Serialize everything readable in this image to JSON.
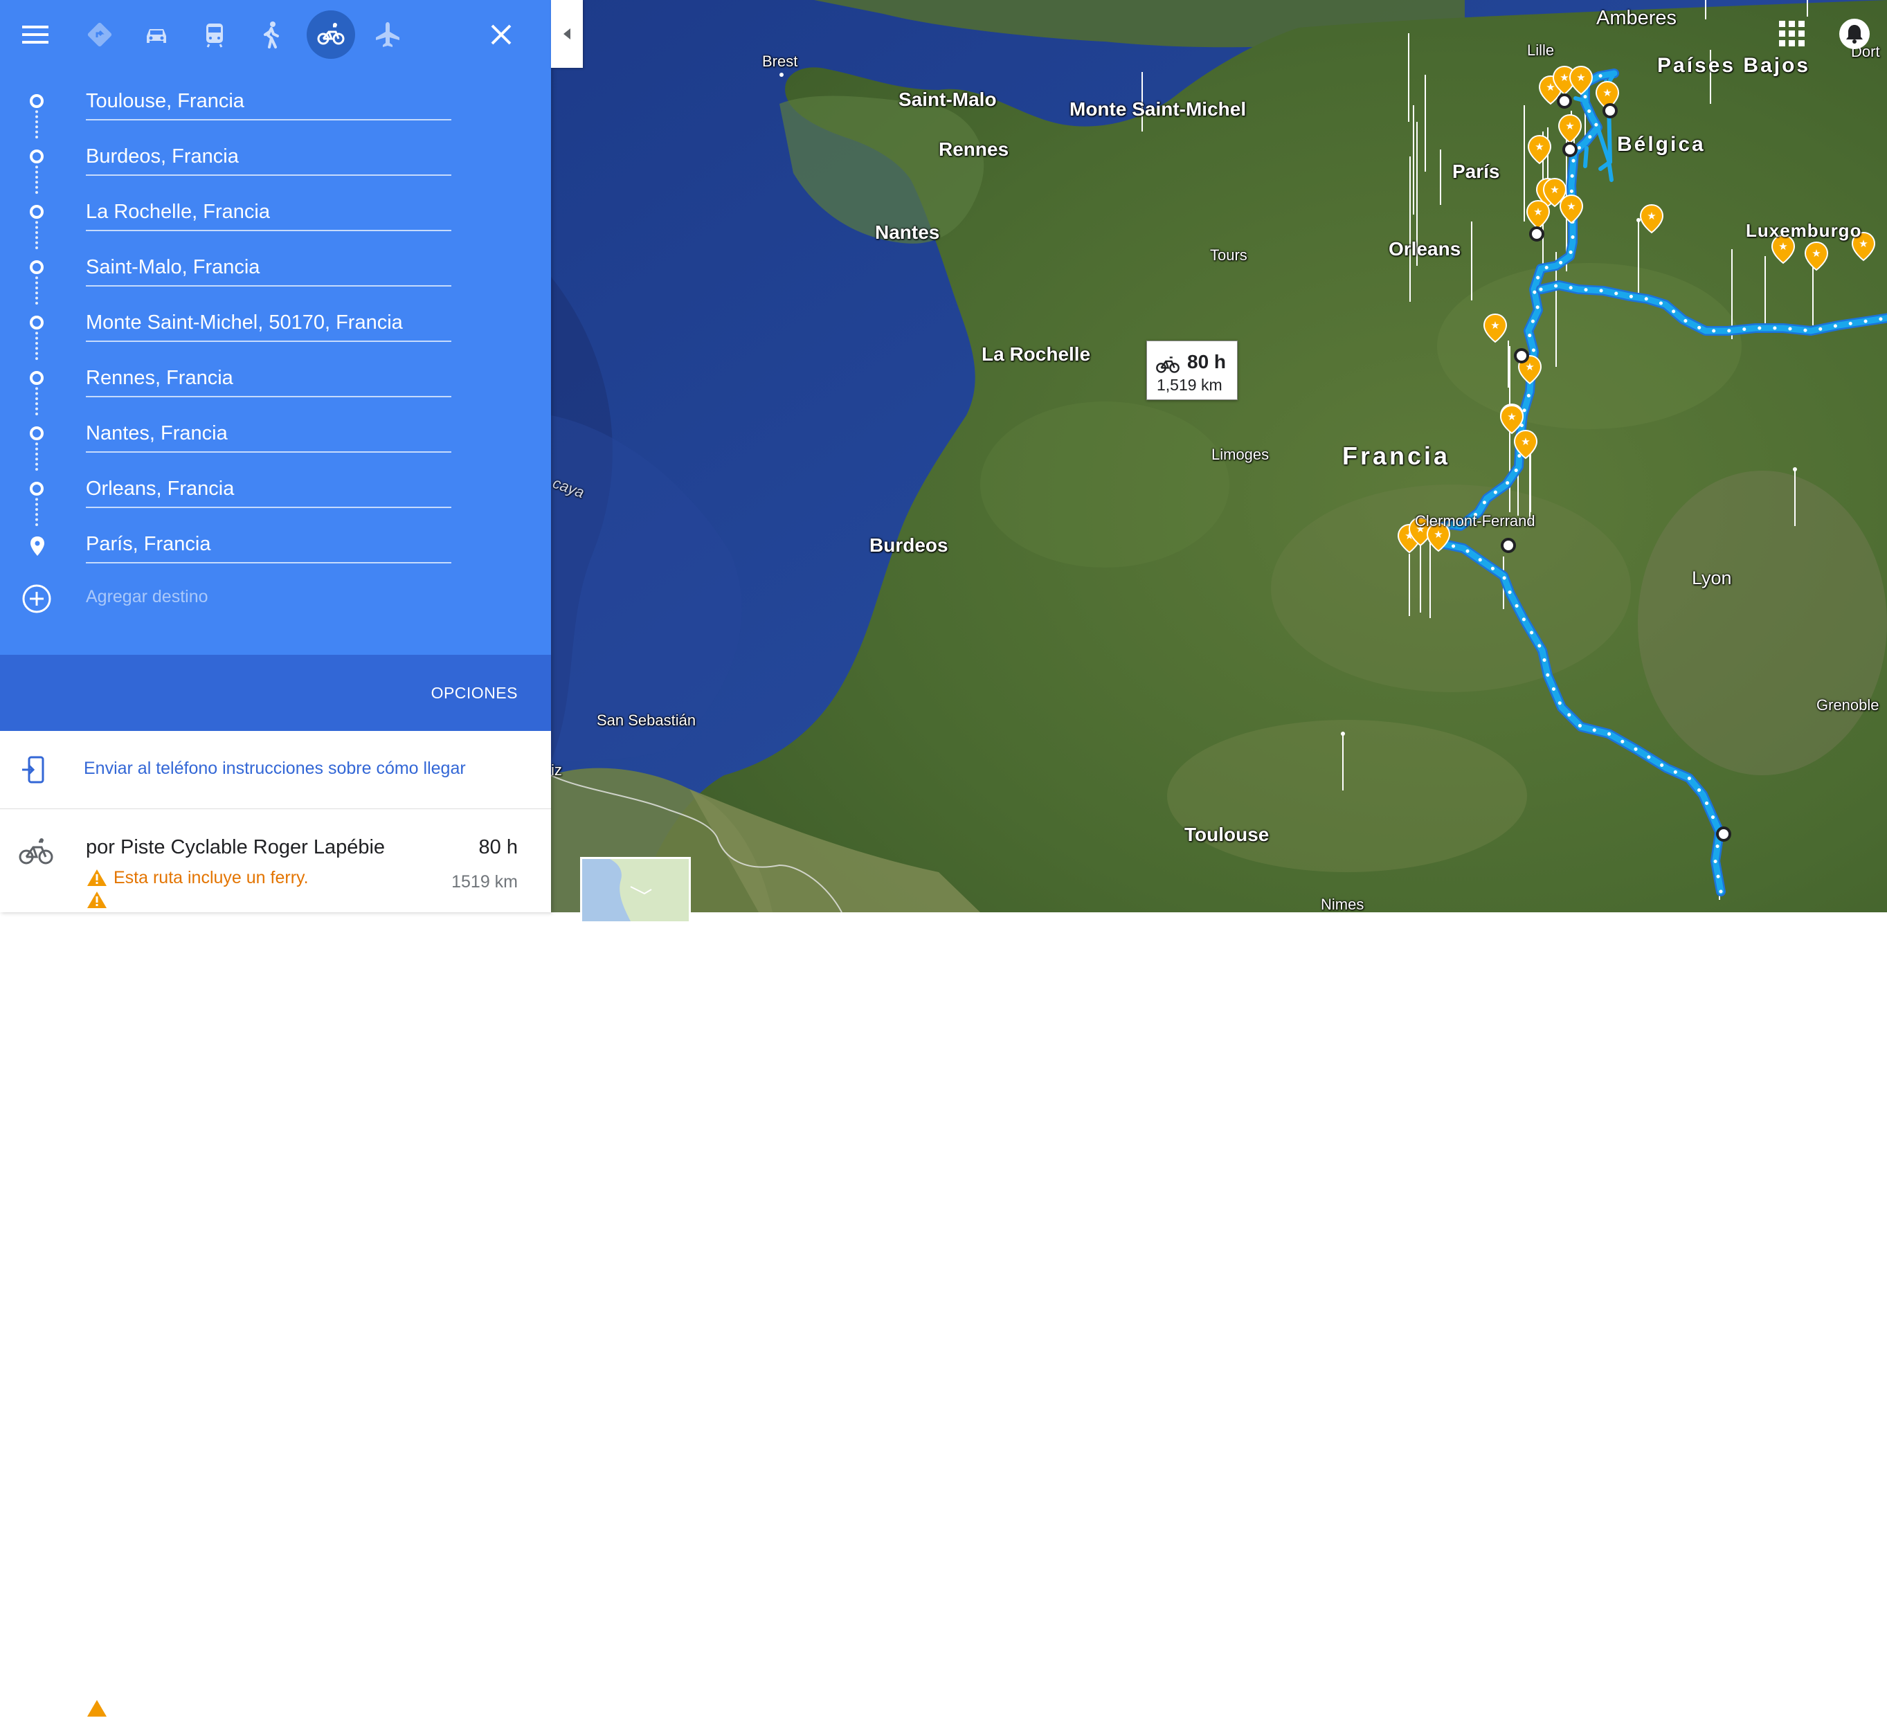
{
  "panel": {
    "close_label": "✕",
    "stops": [
      {
        "label": "Toulouse, Francia"
      },
      {
        "label": "Burdeos, Francia"
      },
      {
        "label": "La Rochelle, Francia"
      },
      {
        "label": "Saint-Malo, Francia"
      },
      {
        "label": "Monte Saint-Michel, 50170, Francia"
      },
      {
        "label": "Rennes, Francia"
      },
      {
        "label": "Nantes, Francia"
      },
      {
        "label": "Orleans, Francia"
      },
      {
        "label": "París, Francia"
      }
    ],
    "add_destination": "Agregar destino",
    "options_label": "OPCIONES",
    "send_label": "Enviar al teléfono instrucciones sobre cómo llegar",
    "route": {
      "title": "por Piste Cyclable Roger Lapébie",
      "time": "80 h",
      "distance": "1519 km",
      "warning": "Esta ruta incluye un ferry."
    }
  },
  "map": {
    "bubble_time": "80 h",
    "bubble_distance": "1,519 km",
    "labels": {
      "brest": "Brest",
      "saint_malo": "Saint-Malo",
      "monte_saint_michel": "Monte Saint-Michel",
      "rennes": "Rennes",
      "nantes": "Nantes",
      "la_rochelle": "La Rochelle",
      "burdeos": "Burdeos",
      "toulouse": "Toulouse",
      "orleans": "Orleans",
      "paris": "París",
      "tours": "Tours",
      "limoges": "Limoges",
      "clermont": "Clermont-Ferrand",
      "lyon": "Lyon",
      "grenoble": "Grenoble",
      "nimes": "Nimes",
      "san_sebastian": "San Sebastián",
      "lille": "Lille",
      "amberes": "Amberes",
      "francia": "Francia",
      "belgica": "Bélgica",
      "paises_bajos": "Países Bajos",
      "luxemburgo": "Luxemburgo",
      "dort": "Dort",
      "vizcaya": "caya",
      "iz": "iz"
    }
  },
  "colors": {
    "panel_blue": "#4285f4",
    "options_blue": "#3267d6",
    "route_blue": "#1a9cf0",
    "warning": "#e37400"
  }
}
